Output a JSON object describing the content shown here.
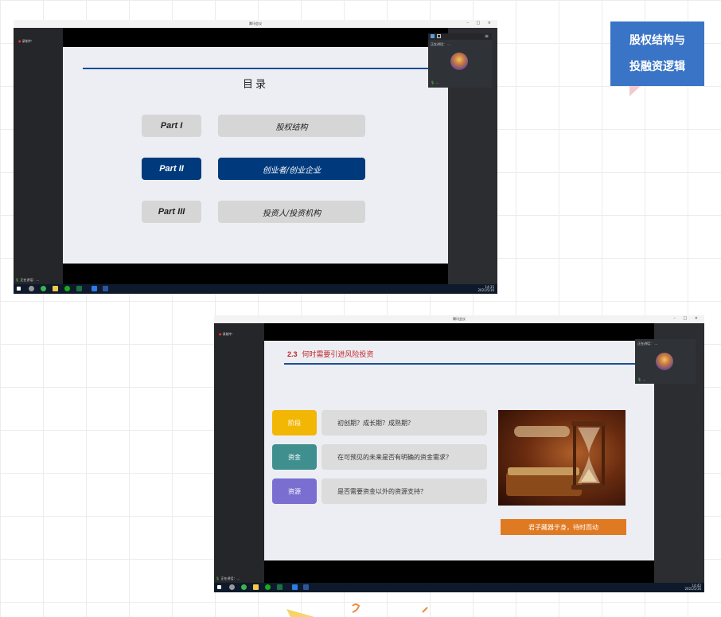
{
  "side_card": {
    "line1": "股权结构与",
    "line2": "投融资逻辑"
  },
  "window1": {
    "title": "腾讯会议",
    "controls": "– □ ×",
    "recording": "录制中",
    "bottom_status": "正在讲话：...",
    "panel_header": "正在讲话：",
    "speaker": "...",
    "slide": {
      "heading": "目录",
      "items": [
        {
          "part": "Part I",
          "title": "股权结构",
          "active": false
        },
        {
          "part": "Part II",
          "title": "创业者/创业企业",
          "active": true
        },
        {
          "part": "Part III",
          "title": "投资人/投资机构",
          "active": false
        }
      ]
    },
    "tray": {
      "time": "14:35",
      "date": "2021/5/16"
    }
  },
  "window2": {
    "title": "腾讯会议",
    "controls": "– □ ×",
    "recording": "录制中",
    "bottom_status": "正在讲话：...",
    "panel_header": "正在讲话：",
    "speaker": "...",
    "slide": {
      "section_num": "2.3",
      "section_title": "何时需要引进风险投资",
      "rows": [
        {
          "label": "阶段",
          "question": "初创期？成长期？成熟期？",
          "color": "#f2b705"
        },
        {
          "label": "资金",
          "question": "在可预见的未来是否有明确的资金需求？",
          "color": "#3f8f8f"
        },
        {
          "label": "资源",
          "question": "是否需要资金以外的资源支持？",
          "color": "#7a6fd0"
        }
      ],
      "banner": "君子藏器于身，待时而动"
    },
    "tray": {
      "time": "14:42",
      "date": "2021/5/16"
    }
  },
  "colors": {
    "accent_blue": "#003a7d",
    "card_blue": "#3a74c6",
    "orange": "#e07a22",
    "red_title": "#c0262d"
  }
}
